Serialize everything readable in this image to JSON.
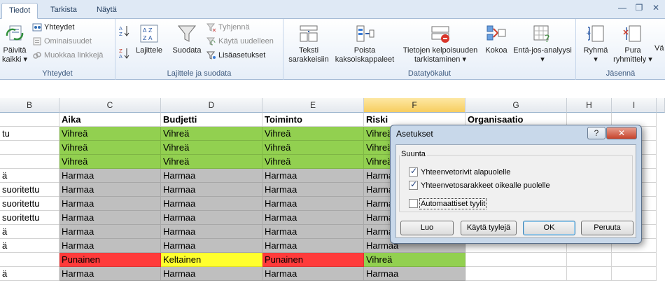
{
  "tabs": [
    "Tiedot",
    "Tarkista",
    "Näytä"
  ],
  "active_tab": "Tiedot",
  "window_controls": {
    "minimize": "—",
    "restore": "❐",
    "close": "✕"
  },
  "ribbon": {
    "groups": {
      "yhteydet": "Yhteydet",
      "lajittele": "Lajittele ja suodata",
      "datatyokalut": "Datatyökalut",
      "jasenna": "Jäsennä"
    },
    "refresh": {
      "line1": "Päivitä",
      "line2": "kaikki ▾"
    },
    "connections": "Yhteydet",
    "properties": "Ominaisuudet",
    "edit_links": "Muokkaa linkkejä",
    "sort_az": "A→Z",
    "sort_za": "Z→A",
    "sort": "Lajittele",
    "filter": "Suodata",
    "clear": "Tyhjennä",
    "reapply": "Käytä uudelleen",
    "advanced": "Lisäasetukset",
    "text_to_columns": {
      "line1": "Teksti",
      "line2": "sarakkeisiin"
    },
    "remove_duplicates": {
      "line1": "Poista",
      "line2": "kaksoiskappaleet"
    },
    "data_validation": {
      "line1": "Tietojen kelpoisuuden",
      "line2": "tarkistaminen ▾"
    },
    "consolidate": "Kokoa",
    "what_if": "Entä-jos-analyysi",
    "group": "Ryhmä",
    "ungroup": {
      "line1": "Pura",
      "line2": "ryhmittely ▾"
    },
    "subtotal": "Vä"
  },
  "columns": [
    "B",
    "C",
    "D",
    "E",
    "F",
    "G",
    "H",
    "I"
  ],
  "selected_column": "F",
  "headers": [
    "",
    "Aika",
    "Budjetti",
    "Toiminto",
    "Riski",
    "Organisaatio"
  ],
  "rows": [
    {
      "b": "tu",
      "c": "Vihreä",
      "d": "Vihreä",
      "e": "Vihreä",
      "f": "Vihreä"
    },
    {
      "b": "",
      "c": "Vihreä",
      "d": "Vihreä",
      "e": "Vihreä",
      "f": "Vihreä"
    },
    {
      "b": "",
      "c": "Vihreä",
      "d": "Vihreä",
      "e": "Vihreä",
      "f": "Vihreä"
    },
    {
      "b": "ä",
      "c": "Harmaa",
      "d": "Harmaa",
      "e": "Harmaa",
      "f": "Harmaa"
    },
    {
      "b": "suoritettu",
      "c": "Harmaa",
      "d": "Harmaa",
      "e": "Harmaa",
      "f": "Harmaa"
    },
    {
      "b": "suoritettu",
      "c": "Harmaa",
      "d": "Harmaa",
      "e": "Harmaa",
      "f": "Harmaa"
    },
    {
      "b": "suoritettu",
      "c": "Harmaa",
      "d": "Harmaa",
      "e": "Harmaa",
      "f": "Harmaa"
    },
    {
      "b": "ä",
      "c": "Harmaa",
      "d": "Harmaa",
      "e": "Harmaa",
      "f": "Harmaa"
    },
    {
      "b": "ä",
      "c": "Harmaa",
      "d": "Harmaa",
      "e": "Harmaa",
      "f": "Harmaa"
    },
    {
      "b": "",
      "c": "Punainen",
      "d": "Keltainen",
      "e": "Punainen",
      "f": "Vihreä"
    },
    {
      "b": "ä",
      "c": "Harmaa",
      "d": "Harmaa",
      "e": "Harmaa",
      "f": "Harmaa"
    }
  ],
  "dialog": {
    "title": "Asetukset",
    "help": "?",
    "close": "✕",
    "section": "Suunta",
    "opt_rows_below": "Yhteenvetorivit alapuolelle",
    "opt_cols_right": "Yhteenvetosarakkeet oikealle puolelle",
    "opt_auto_styles": "Automaattiset tyylit",
    "create": "Luo",
    "apply_styles": "Käytä tyylejä",
    "ok": "OK",
    "cancel": "Peruuta"
  },
  "colors": {
    "green": "#92d050",
    "gray": "#bfbfbf",
    "red": "#ff3b3b",
    "yellow": "#ffff2e",
    "selected_header": "#f7cd5f"
  }
}
